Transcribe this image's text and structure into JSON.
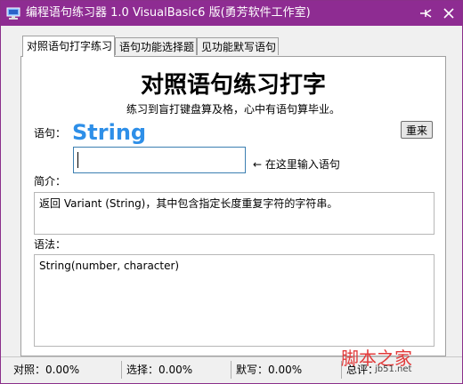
{
  "window": {
    "title": "编程语句练习器 1.0 VisualBasic6 版(勇芳软件工作室)",
    "accent_color": "#8e2c92",
    "pin_icon": "pin-icon",
    "close_icon": "close-icon"
  },
  "tabs": [
    {
      "label": "对照语句打字练习",
      "active": true
    },
    {
      "label": "语句功能选择题",
      "active": false
    },
    {
      "label": "见功能默写语句",
      "active": false
    }
  ],
  "panel": {
    "heading": "对照语句练习打字",
    "subtitle": "练习到盲打键盘算及格，心中有语句算毕业。",
    "statement_label": "语句：",
    "statement_word": "String",
    "statement_color": "#2e8fe8",
    "redo_button": "重来",
    "input_value": "",
    "input_hint": "← 在这里输入语句",
    "intro_label": "简介：",
    "intro_text": "返回 Variant (String)，其中包含指定长度重复字符的字符串。",
    "syntax_label": "语法：",
    "syntax_text": "String(number, character)"
  },
  "status": {
    "dictation": "对照：0.00%",
    "choice": "选择：0.00%",
    "recall": "默写：0.00%",
    "total": "总评："
  },
  "watermark": {
    "text": "脚本之家",
    "url": "jb51.net"
  }
}
